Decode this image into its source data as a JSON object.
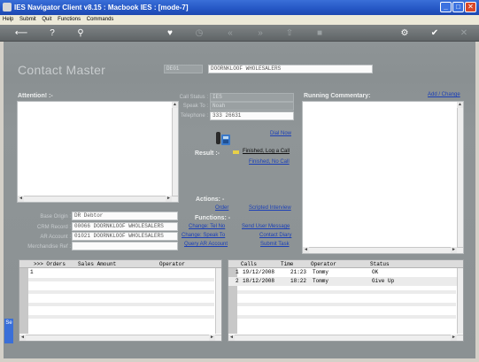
{
  "window": {
    "title": "IES Navigator Client v8.15 : Macbook IES :      [mode-7]",
    "minimize_glyph": "_",
    "maximize_glyph": "□",
    "close_glyph": "✕"
  },
  "menu": [
    "Help",
    "Submit",
    "Quit",
    "Functions",
    "Commands"
  ],
  "toolbar": {
    "glyphs": [
      "⟵",
      "?",
      "⚲",
      "♥",
      "◷",
      "«",
      "»",
      "⇧",
      "■",
      "⚙",
      "✔",
      "✕"
    ]
  },
  "header": {
    "title": "Contact Master",
    "code_value": "DE01",
    "name_value": "DOORNKLOOF WHOLESALERS"
  },
  "attention": {
    "label": "Attention! :-"
  },
  "call": {
    "call_status_label": "Call Status :",
    "call_status_value": "IES",
    "speak_to_label": "Speak To :",
    "speak_to_value": "Noah",
    "telephone_label": "Telephone :",
    "telephone_value": "333 26631",
    "dial_now": "Dial Now"
  },
  "commentary": {
    "label": "Running Commentary:",
    "add_change": "Add / Change"
  },
  "result": {
    "label": "Result :-",
    "finished_log": "Finished, Log a Call",
    "finished_no_call": "Finished, No Call"
  },
  "actions": {
    "label": "Actions: -",
    "order": "Order",
    "scripted_interview": "Scripted Interview",
    "functions_label": "Functions: -",
    "change_tel_no": "Change: Tel No",
    "send_user_message": "Send User Message",
    "change_speak_to": "Change: Speak To",
    "contact_diary": "Contact Diary",
    "query_ar_account": "Query AR Account",
    "submit_task": "Submit Task"
  },
  "details": {
    "base_origin_label": "Base Origin :",
    "base_origin_value": "DR Debtor",
    "crm_record_label": "CRM Record :",
    "crm_record_value": "00066 DOORNKLOOF WHOLESALERS",
    "ar_account_label": "AR Account :",
    "ar_account_value": "01021 DOORNKLOOF WHOLESALERS",
    "merchandise_ref_label": "Merchandise Ref :",
    "merchandise_ref_value": ""
  },
  "orders_grid": {
    "headers": [
      ">>> Orders",
      "Sales Amount",
      "Operator"
    ],
    "rows": [
      {
        "no": "1",
        "orders": "",
        "amount": "",
        "operator": ""
      }
    ]
  },
  "calls_grid": {
    "headers": [
      "Calls",
      "Time",
      "Operator",
      "Status"
    ],
    "rows": [
      {
        "no": "1",
        "date": "19/12/2008",
        "time": "21:23",
        "operator": "Tommy",
        "status": "OK"
      },
      {
        "no": "2",
        "date": "18/12/2008",
        "time": "18:22",
        "operator": "Tommy",
        "status": "Give Up"
      }
    ]
  },
  "side_tab": "Se",
  "colors": {
    "title_bar": "#2456c4",
    "client_bg": "#8e9496",
    "link": "#1a3fb8"
  }
}
